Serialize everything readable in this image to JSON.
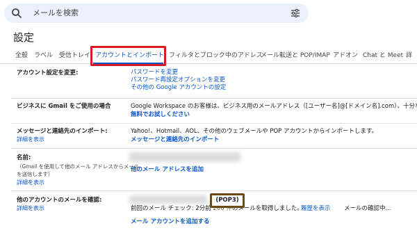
{
  "search": {
    "placeholder": "メールを検索"
  },
  "page": {
    "title": "設定"
  },
  "tabs": [
    {
      "label": "全般"
    },
    {
      "label": "ラベル"
    },
    {
      "label": "受信トレイ"
    },
    {
      "label": "アカウントとインポート"
    },
    {
      "label": "フィルタとブロック中のアドレス"
    },
    {
      "label": "メール転送と POP/IMAP"
    },
    {
      "label": "アドオン"
    },
    {
      "label": "Chat と Meet"
    },
    {
      "label": "詳"
    }
  ],
  "colors": {
    "accent": "#0b57d0",
    "highlight_red": "#d71920",
    "highlight_brown": "#6b4a12"
  },
  "sections": {
    "change_account": {
      "label": "アカウント設定を変更:",
      "links": [
        "パスワードを変更",
        "パスワード再設定オプションを変更",
        "その他の Google アカウントの設定"
      ]
    },
    "business": {
      "label": "ビジネスに Gmail をご使用の場合",
      "text": "Google Workspace のお客様は、ビジネス用のメールアドレス（[ユーザー名]@[ドメイン名].com）、十分な保",
      "link": "無料でお試しください"
    },
    "import": {
      "label": "メッセージと連絡先のインポート:",
      "detail_link": "詳細を表示",
      "text": "Yahoo!、Hotmail、AOL、その他のウェブメールや POP アカウントからインポートします。",
      "action_link": "メッセージと連絡先のインポート"
    },
    "name": {
      "label": "名前:",
      "sub_line1": "（Gmail を使用して他のメール アドレスからメール",
      "sub_line2": "を送信します）",
      "detail_link": "詳細を表示",
      "action_link": "他のメール アドレスを追加"
    },
    "check_mail": {
      "label": "他のアカウントのメールを確認:",
      "detail_link": "詳細を表示",
      "pop3": "(POP3)",
      "status_prefix": "前回のメール チェック: 2分前",
      "status_count": "200 件",
      "status_suffix": "のメールを取得しました。",
      "history_link": "履歴を表示",
      "status_tail": "メールの確認中...",
      "action_link": "メール アカウントを追加する"
    }
  }
}
